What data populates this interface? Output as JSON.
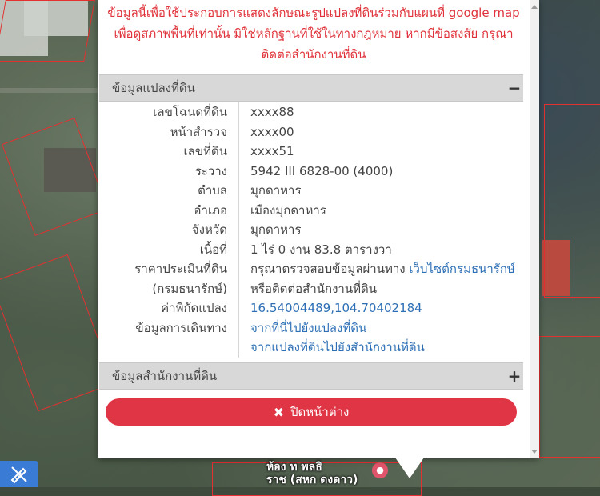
{
  "disclaimer": {
    "line1": "ข้อมูลนี้เพื่อใช้ประกอบการแสดงลักษณะรูปแปลงที่ดินร่วมกับแผนที่ google map",
    "line2": "เพื่อดูสภาพพื้นที่เท่านั้น มิใช่หลักฐานที่ใช้ในทางกฎหมาย หากมีข้อสงสัย กรุณา",
    "line3": "ติดต่อสำนักงานที่ดิน"
  },
  "panel_parcel": {
    "title": "ข้อมูลแปลงที่ดิน",
    "toggle": "−",
    "rows": [
      {
        "label": "เลขโฉนดที่ดิน",
        "value": "xxxx88"
      },
      {
        "label": "หน้าสำรวจ",
        "value": "xxxx00"
      },
      {
        "label": "เลขที่ดิน",
        "value": "xxxx51"
      },
      {
        "label": "ระวาง",
        "value": "5942 III 6828-00 (4000)"
      },
      {
        "label": "ตำบล",
        "value": "มุกดาหาร"
      },
      {
        "label": "อำเภอ",
        "value": "เมืองมุกดาหาร"
      },
      {
        "label": "จังหวัด",
        "value": "มุกดาหาร"
      },
      {
        "label": "เนื้อที่",
        "value": "1 ไร่ 0 งาน 83.8 ตารางวา"
      }
    ],
    "price_label_1": "ราคาประเมินที่ดิน",
    "price_label_2": "(กรมธนารักษ์)",
    "price_text_1": "กรุณาตรวจสอบข้อมูลผ่านทาง ",
    "price_link": "เว็บไซต์กรมธนารักษ์",
    "price_text_2": "หรือติดต่อสำนักงานที่ดิน",
    "coord_label": "ค่าพิกัดแปลง",
    "coord_value": "16.54004489,104.70402184",
    "travel_label": "ข้อมูลการเดินทาง",
    "travel_link_1": "จากที่นี่ไปยังแปลงที่ดิน",
    "travel_link_2": "จากแปลงที่ดินไปยังสำนักงานที่ดิน"
  },
  "panel_office": {
    "title": "ข้อมูลสำนักงานที่ดิน",
    "toggle": "+"
  },
  "close_button": {
    "label": "ปิดหน้าต่าง"
  },
  "map": {
    "label_line1": "ห้อง    ท  พลธิ",
    "label_line2": "ราช (สหก ดงดาว)"
  },
  "colors": {
    "accent_red": "#df3545",
    "link_blue": "#2d6fb5",
    "disclaimer_red": "#e0323a",
    "tool_blue": "#3a7bd5"
  },
  "icons": {
    "close": "times-icon",
    "tool": "ruler-pencil-icon",
    "pin": "hotel-pin-icon"
  }
}
